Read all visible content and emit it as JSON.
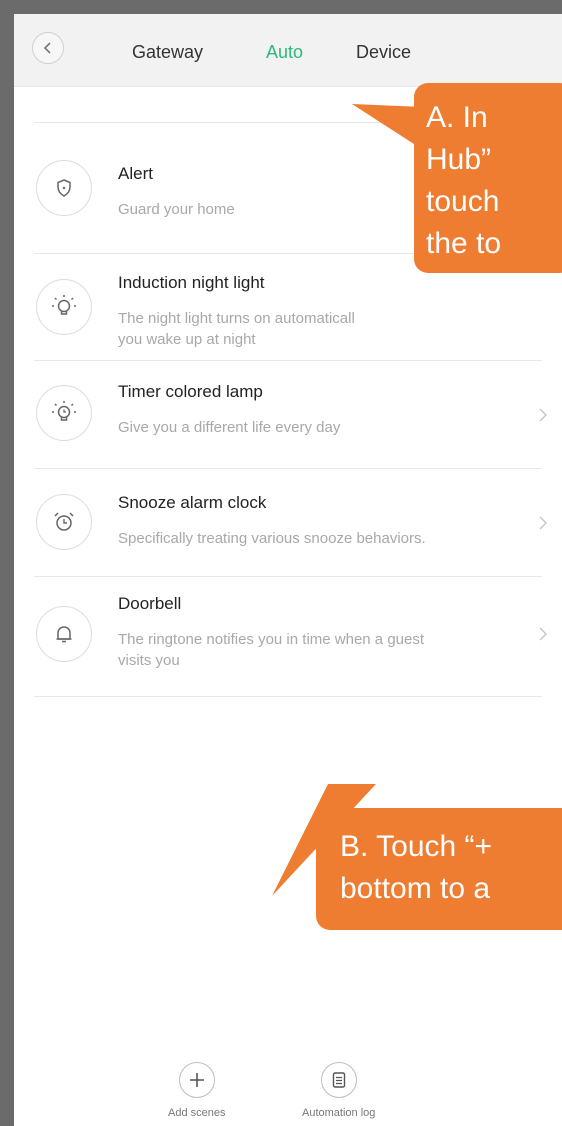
{
  "header": {
    "back_icon": "chevron-left-icon",
    "tabs": [
      {
        "label": "Gateway",
        "active": false
      },
      {
        "label": "Auto",
        "active": true
      },
      {
        "label": "Device",
        "active": false
      }
    ],
    "active_color": "#2eb87a"
  },
  "scenes": [
    {
      "icon": "shield-icon",
      "title": "Alert",
      "subtitle": [
        "Guard your home"
      ]
    },
    {
      "icon": "bulb-icon",
      "title": "Induction night light",
      "subtitle": [
        "The night light turns on automaticall",
        "you wake up at night"
      ]
    },
    {
      "icon": "timer-bulb-icon",
      "title": "Timer colored lamp",
      "subtitle": [
        "Give you a different life every day"
      ]
    },
    {
      "icon": "alarm-clock-icon",
      "title": "Snooze alarm clock",
      "subtitle": [
        "Specifically treating various snooze behaviors."
      ]
    },
    {
      "icon": "bell-icon",
      "title": "Doorbell",
      "subtitle": [
        "The ringtone notifies you in time when a guest",
        "visits you"
      ]
    }
  ],
  "callouts": {
    "a": {
      "lines": [
        "A. In",
        "Hub”",
        "touch",
        "the to"
      ]
    },
    "b": {
      "lines": [
        "B. Touch “+",
        "bottom to a"
      ]
    },
    "color": "#ee7d31"
  },
  "bottom_bar": {
    "add": {
      "icon": "plus-icon",
      "label": "Add scenes"
    },
    "log": {
      "icon": "document-icon",
      "label": "Automation log"
    }
  }
}
